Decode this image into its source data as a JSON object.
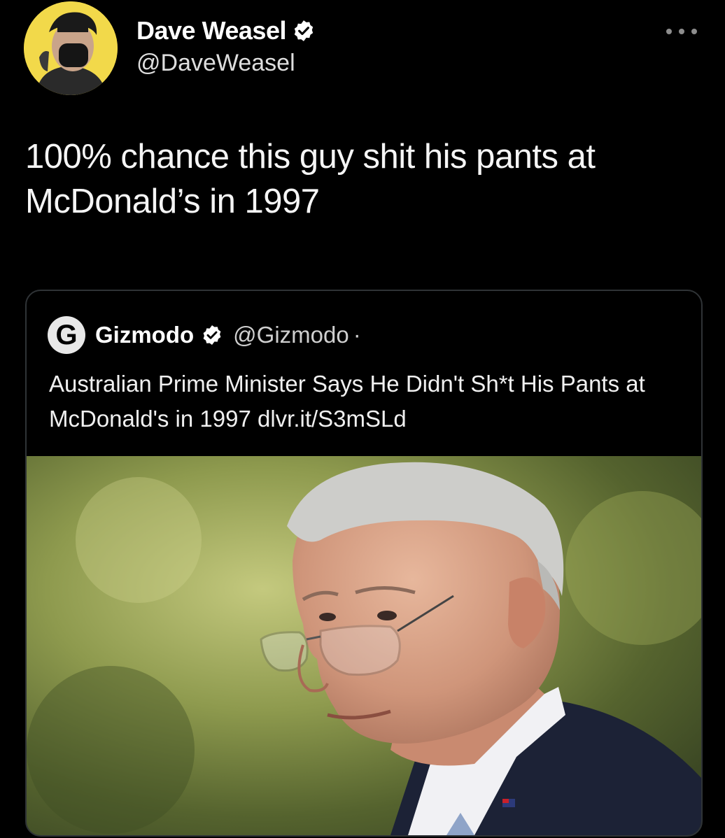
{
  "author": {
    "name": "Dave Weasel",
    "handle": "@DaveWeasel",
    "verified_icon": "verified-badge-icon"
  },
  "tweet": {
    "text": "100% chance this guy shit his pants at McDonald’s in 1997"
  },
  "quoted": {
    "logo_letter": "G",
    "name": "Gizmodo",
    "handle": "@Gizmodo",
    "separator": "·",
    "text": "Australian Prime Minister Says He Didn't Sh*t His Pants at McDonald's in 1997 dlvr.it/S3mSLd"
  },
  "colors": {
    "background": "#000000",
    "text": "#ffffff",
    "muted": "#8d8d8d",
    "card_border": "#2f3336",
    "avatar_bg": "#f2d94a"
  }
}
